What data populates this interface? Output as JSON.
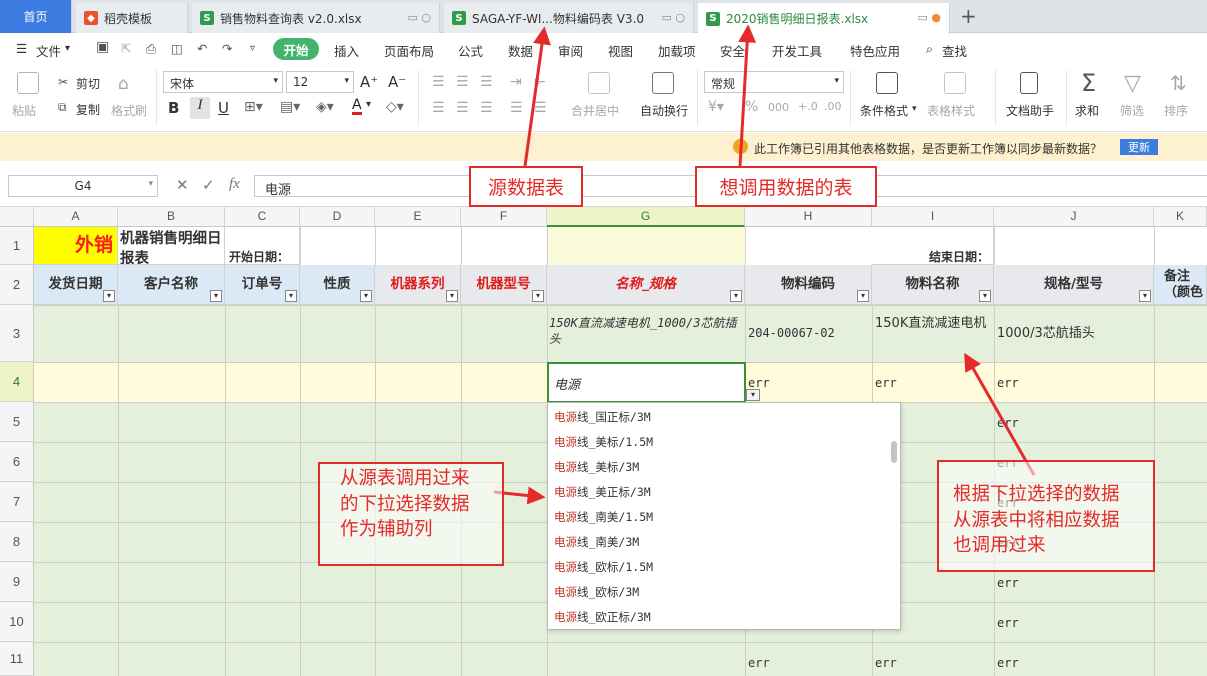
{
  "tabs": [
    {
      "label": "首页"
    },
    {
      "label": "稻壳模板"
    },
    {
      "label": "销售物料查询表 v2.0.xlsx"
    },
    {
      "label": "SAGA-YF-WI...物料编码表 V3.0"
    },
    {
      "label": "2020销售明细日报表.xlsx"
    }
  ],
  "new_tab_label": "+",
  "menu": {
    "file": "文件",
    "start": "开始",
    "items": [
      "插入",
      "页面布局",
      "公式",
      "数据",
      "审阅",
      "视图",
      "加载项",
      "安全",
      "开发工具",
      "特色应用"
    ],
    "search": "查找"
  },
  "ribbon": {
    "paste": "粘贴",
    "cut": "剪切",
    "copy": "复制",
    "format_painter": "格式刷",
    "font_name": "宋体",
    "font_size": "12",
    "merge_center": "合并居中",
    "wrap_text": "自动换行",
    "number_format": "常规",
    "conditional_format": "条件格式",
    "table_style": "表格样式",
    "doc_helper": "文档助手",
    "sum": "求和",
    "filter": "筛选",
    "sort": "排序"
  },
  "notice": {
    "text": "此工作簿已引用其他表格数据，是否更新工作簿以同步最新数据？",
    "button": "更新"
  },
  "formula_bar": {
    "cell_ref": "G4",
    "value": "电源"
  },
  "columns": [
    "A",
    "B",
    "C",
    "D",
    "E",
    "F",
    "G",
    "H",
    "I",
    "J",
    "K"
  ],
  "rows": [
    "1",
    "2",
    "3",
    "4",
    "5",
    "6",
    "7",
    "8",
    "9",
    "10",
    "11"
  ],
  "sheet": {
    "a1": "外销",
    "b1": "机器销售明细日报表",
    "c1": "开始日期：",
    "j1": "结束日期：",
    "headers": [
      "发货日期",
      "客户名称",
      "订单号",
      "性质",
      "机器系列",
      "机器型号",
      "名称_规格",
      "物料编码",
      "物料名称",
      "规格/型号",
      "备注（颜色"
    ],
    "g3": "150K直流减速电机_1000/3芯航插头",
    "h3": "204-00067-02",
    "i3": "150K直流减速电机",
    "j3": "1000/3芯航插头",
    "g4": "电源",
    "err": "err"
  },
  "dropdown": {
    "match": "电源",
    "items": [
      "线_国正标/3M",
      "线_美标/1.5M",
      "线_美标/3M",
      "线_美正标/3M",
      "线_南美/1.5M",
      "线_南美/3M",
      "线_欧标/1.5M",
      "线_欧标/3M",
      "线_欧正标/3M"
    ]
  },
  "annotations": {
    "source": "源数据表",
    "target": "想调用数据的表",
    "helper": [
      "从源表调用过来",
      "的下拉选择数据",
      "作为辅助列"
    ],
    "lookup": [
      "根据下拉选择的数据",
      "从源表中将相应数据",
      "也调用过来"
    ]
  },
  "colors": {
    "accent_green": "#45b36b",
    "tab_home": "#3c7be0",
    "annotation_red": "#e52a2a",
    "header_blue": "#dbe9f6"
  }
}
